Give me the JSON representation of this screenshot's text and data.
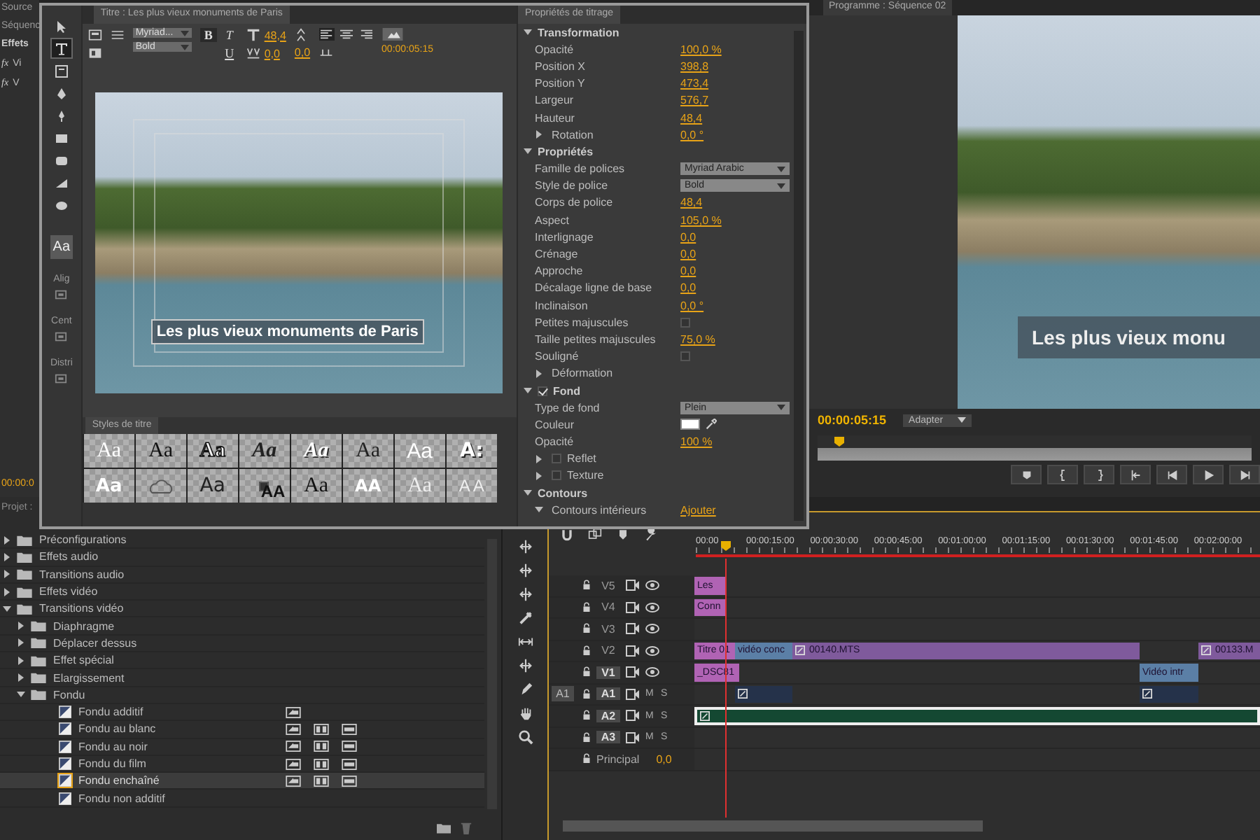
{
  "left_panel": {
    "tabs": [
      "Source",
      "Séquenc"
    ],
    "heading": "Effets",
    "fx_rows": [
      {
        "badge": "fx",
        "label": "Vi"
      },
      {
        "badge": "fx",
        "label": "V"
      }
    ],
    "timecode": "00:00:0",
    "bottom_tab": "Projet :"
  },
  "title_window": {
    "tab": "Titre : Les plus vieux monuments de Paris",
    "tools": [
      {
        "kind": "select",
        "selected": false
      },
      {
        "kind": "type",
        "selected": true
      },
      {
        "kind": "area",
        "selected": false
      },
      {
        "kind": "pen",
        "selected": false
      },
      {
        "kind": "anchor",
        "selected": false
      },
      {
        "kind": "rect",
        "selected": false
      },
      {
        "kind": "rounded",
        "selected": false
      },
      {
        "kind": "wedge",
        "selected": false
      },
      {
        "kind": "ellipse",
        "selected": false
      }
    ],
    "style_preview": "Aa",
    "tool_labels": [
      "Alig",
      "Cent",
      "Distri"
    ],
    "toolbar": {
      "font": "Myriad...",
      "style": "Bold",
      "format_buttons": [
        {
          "label": "B",
          "kind": "bold"
        },
        {
          "label": "T",
          "kind": "italic"
        },
        {
          "label": "U",
          "kind": "underline"
        }
      ],
      "size": "48,4",
      "kerning": "0,0",
      "leading": "0,0",
      "align": [
        {
          "kind": "left",
          "selected": true
        },
        {
          "kind": "center",
          "selected": false
        },
        {
          "kind": "right",
          "selected": false
        }
      ],
      "timecode": "00:00:05:15"
    },
    "canvas": {
      "title_text": "Les plus vieux monuments de Paris"
    },
    "styles_panel": {
      "tab": "Styles de titre",
      "samples": [
        {
          "label": "Aa",
          "kind": "serif-white"
        },
        {
          "label": "Aa",
          "kind": "serif-black"
        },
        {
          "label": "Aa",
          "kind": "serif-outline"
        },
        {
          "label": "Aa",
          "kind": "script-dark"
        },
        {
          "label": "Aa",
          "kind": "script-white"
        },
        {
          "label": "Aa",
          "kind": "serif-dark"
        },
        {
          "label": "Aa",
          "kind": "serif-light"
        },
        {
          "label": "A:",
          "kind": "heavy-white"
        },
        {
          "label": "Aa",
          "kind": "bold-white"
        },
        {
          "kind": "picture"
        },
        {
          "label": "Aa",
          "kind": "outline-heavy"
        },
        {
          "label": "AA",
          "kind": "condensed-black"
        },
        {
          "label": "Aa",
          "kind": "serif-black"
        },
        {
          "label": "AA",
          "kind": "caps-white"
        },
        {
          "label": "Aa",
          "kind": "serif-gray"
        },
        {
          "label": "A A",
          "kind": "spaced-white"
        }
      ]
    },
    "properties": {
      "tab": "Propriétés de titrage",
      "sections": [
        {
          "label": "Transformation",
          "expanded": true,
          "rows": [
            {
              "kind": "value",
              "label": "Opacité",
              "value": "100,0 %"
            },
            {
              "kind": "value",
              "label": "Position X",
              "value": "398,8"
            },
            {
              "kind": "value",
              "label": "Position Y",
              "value": "473,4"
            },
            {
              "kind": "value",
              "label": "Largeur",
              "value": "576,7"
            },
            {
              "kind": "value",
              "label": "Hauteur",
              "value": "48,4"
            },
            {
              "kind": "group",
              "label": "Rotation",
              "expanded": false,
              "value": "0,0 °"
            }
          ]
        },
        {
          "label": "Propriétés",
          "expanded": true,
          "rows": [
            {
              "kind": "dropdown",
              "label": "Famille de polices",
              "value": "Myriad Arabic"
            },
            {
              "kind": "dropdown",
              "label": "Style de police",
              "value": "Bold"
            },
            {
              "kind": "value",
              "label": "Corps de police",
              "value": "48,4"
            },
            {
              "kind": "value",
              "label": "Aspect",
              "value": "105,0 %"
            },
            {
              "kind": "value",
              "label": "Interlignage",
              "value": "0,0"
            },
            {
              "kind": "value",
              "label": "Crénage",
              "value": "0,0"
            },
            {
              "kind": "value",
              "label": "Approche",
              "value": "0,0"
            },
            {
              "kind": "value",
              "label": "Décalage ligne de base",
              "value": "0,0"
            },
            {
              "kind": "value",
              "label": "Inclinaison",
              "value": "0,0 °"
            },
            {
              "kind": "checkbox",
              "label": "Petites majuscules",
              "checked": false
            },
            {
              "kind": "value",
              "label": "Taille petites majuscules",
              "value": "75,0 %"
            },
            {
              "kind": "checkbox",
              "label": "Souligné",
              "checked": false
            },
            {
              "kind": "group",
              "label": "Déformation",
              "expanded": false
            }
          ]
        },
        {
          "label": "Fond",
          "expanded": true,
          "checked": true,
          "rows": [
            {
              "kind": "dropdown",
              "label": "Type de fond",
              "value": "Plein"
            },
            {
              "kind": "color",
              "label": "Couleur",
              "color": "#ffffff"
            },
            {
              "kind": "value",
              "label": "Opacité",
              "value": "100 %"
            },
            {
              "kind": "group",
              "label": "Reflet",
              "expanded": false,
              "checked": false
            },
            {
              "kind": "group",
              "label": "Texture",
              "expanded": false,
              "checked": false
            }
          ]
        },
        {
          "label": "Contours",
          "expanded": true,
          "rows": [
            {
              "kind": "group",
              "label": "Contours intérieurs",
              "expanded": true,
              "link": "Ajouter"
            }
          ]
        }
      ]
    }
  },
  "program_monitor": {
    "tab": "Programme : Séquence 02",
    "overlay_text": "Les plus vieux monu",
    "timecode": "00:00:05:15",
    "fit": "Adapter"
  },
  "effects_panel": {
    "tree": [
      {
        "kind": "folder",
        "label": "Préconfigurations",
        "expanded": false,
        "selected": false
      },
      {
        "kind": "folder",
        "label": "Effets audio",
        "expanded": false,
        "selected": false
      },
      {
        "kind": "folder",
        "label": "Transitions audio",
        "expanded": false,
        "selected": false
      },
      {
        "kind": "folder",
        "label": "Effets vidéo",
        "expanded": false,
        "selected": false
      },
      {
        "kind": "folder",
        "label": "Transitions vidéo",
        "expanded": true,
        "selected": false,
        "children": [
          {
            "kind": "folder",
            "label": "Diaphragme",
            "expanded": false,
            "selected": false
          },
          {
            "kind": "folder",
            "label": "Déplacer dessus",
            "expanded": false,
            "selected": false
          },
          {
            "kind": "folder",
            "label": "Effet spécial",
            "expanded": false,
            "selected": false
          },
          {
            "kind": "folder",
            "label": "Elargissement",
            "expanded": false,
            "selected": false
          },
          {
            "kind": "folder",
            "label": "Fondu",
            "expanded": true,
            "selected": false,
            "children": [
              {
                "kind": "transition",
                "label": "Fondu additif",
                "selected": false,
                "accelerated": true,
                "bit32": false,
                "yuv": false
              },
              {
                "kind": "transition",
                "label": "Fondu au blanc",
                "selected": false,
                "accelerated": true,
                "bit32": true,
                "yuv": true
              },
              {
                "kind": "transition",
                "label": "Fondu au noir",
                "selected": false,
                "accelerated": true,
                "bit32": true,
                "yuv": true
              },
              {
                "kind": "transition",
                "label": "Fondu du film",
                "selected": false,
                "accelerated": true,
                "bit32": true,
                "yuv": true
              },
              {
                "kind": "transition",
                "label": "Fondu enchaîné",
                "selected": true,
                "accelerated": true,
                "bit32": true,
                "yuv": true
              },
              {
                "kind": "transition",
                "label": "Fondu non additif",
                "selected": false,
                "accelerated": false,
                "bit32": false,
                "yuv": false
              }
            ]
          }
        ]
      }
    ]
  },
  "timeline": {
    "ruler": [
      "00:00",
      "00:00:15:00",
      "00:00:30:00",
      "00:00:45:00",
      "00:01:00:00",
      "00:01:15:00",
      "00:01:30:00",
      "00:01:45:00",
      "00:02:00:00"
    ],
    "tracks": [
      {
        "kind": "video",
        "name": "V5",
        "targeted": false,
        "clips": [
          {
            "label": "Les",
            "color": "#b063b4",
            "selected": false,
            "fx": false
          }
        ]
      },
      {
        "kind": "video",
        "name": "V4",
        "targeted": false,
        "clips": [
          {
            "label": "Conn",
            "color": "#b063b4",
            "selected": false,
            "fx": false
          }
        ]
      },
      {
        "kind": "video",
        "name": "V3",
        "targeted": false
      },
      {
        "kind": "video",
        "name": "V2",
        "targeted": false,
        "clips": [
          {
            "label": "Titre 01",
            "color": "#b063b4",
            "selected": false,
            "fx": false
          },
          {
            "label": "vidéo conc",
            "color": "#5b7fa6",
            "selected": false,
            "fx": false
          },
          {
            "label": "00140.MTS",
            "color": "#7f5a9c",
            "selected": false,
            "fx": true
          },
          {
            "label": "00133.M",
            "color": "#7f5a9c",
            "selected": false,
            "fx": true
          }
        ]
      },
      {
        "kind": "video",
        "name": "V1",
        "targeted": true,
        "clips": [
          {
            "label": "_DSC81",
            "color": "#b063b4",
            "selected": false,
            "fx": false
          },
          {
            "label": "Vidéo intr",
            "color": "#5b7fa6",
            "selected": false,
            "fx": false
          }
        ]
      },
      {
        "kind": "audio",
        "name": "A1",
        "targeted": true,
        "source_patch": "A1",
        "buttons": [
          "M",
          "S"
        ],
        "clips": [
          {
            "color": "#25324a",
            "selected": false,
            "fx": true
          },
          {
            "color": "#25324a",
            "selected": false,
            "fx": true
          }
        ]
      },
      {
        "kind": "audio",
        "name": "A2",
        "targeted": true,
        "buttons": [
          "M",
          "S"
        ],
        "clips": [
          {
            "color": "#144832",
            "selected": true,
            "fx": true
          }
        ]
      },
      {
        "kind": "audio",
        "name": "A3",
        "targeted": true,
        "buttons": [
          "M",
          "S"
        ]
      },
      {
        "kind": "master",
        "name": "Principal",
        "value": "0,0"
      }
    ]
  }
}
